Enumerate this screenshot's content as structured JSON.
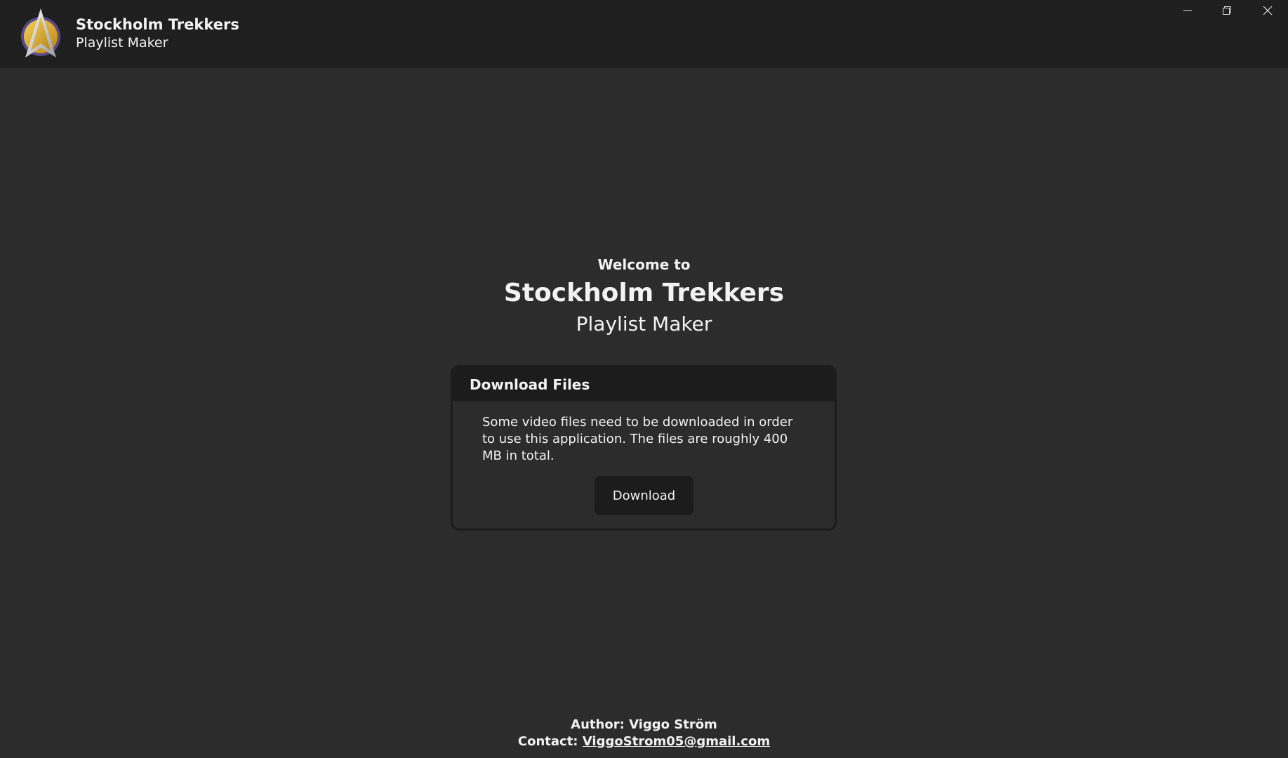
{
  "titlebar": {
    "logo_icon": "starfleet-delta-icon",
    "title": "Stockholm Trekkers",
    "subtitle": "Playlist Maker",
    "window_controls": {
      "minimize_icon": "minimize-icon",
      "maximize_icon": "restore-icon",
      "close_icon": "close-icon"
    }
  },
  "welcome": {
    "prefix": "Welcome to",
    "title": "Stockholm Trekkers",
    "subtitle": "Playlist Maker"
  },
  "download_card": {
    "header": "Download Files",
    "text": "Some video files need to be downloaded in order to use this application. The files are roughly 400 MB in total.",
    "button_label": "Download"
  },
  "footer": {
    "author_label": "Author:",
    "author_name": "Viggo Ström",
    "contact_label": "Contact:",
    "contact_email": "ViggoStrom05@gmail.com"
  },
  "colors": {
    "background": "#2c2c2c",
    "titlebar": "#1f1f1f",
    "card_header": "#1c1c1c",
    "text": "#f2f2f2",
    "logo_gold": "#d9a82e",
    "logo_purple": "#5b4a86"
  }
}
